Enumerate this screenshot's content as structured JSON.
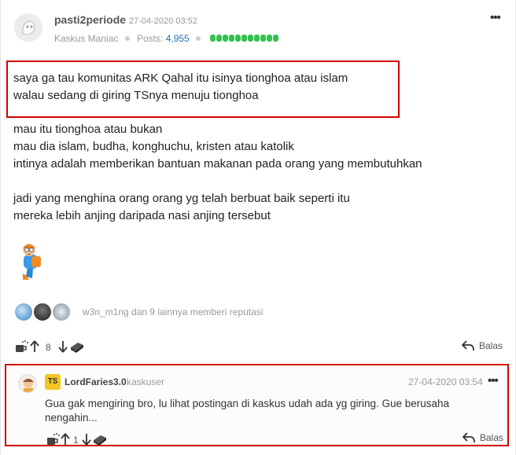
{
  "post": {
    "username": "pasti2periode",
    "timestamp": "27-04-2020 03:52",
    "rank": "Kaskus Maniac",
    "posts_label": "Posts:",
    "posts_count": "4,955",
    "reputation_level": 1.0,
    "highlighted_lines": [
      "saya ga tau komunitas ARK Qahal itu isinya tionghoa atau islam",
      "walau sedang di giring TSnya menuju tionghoa"
    ],
    "body_lines": [
      "mau itu tionghoa atau bukan",
      "mau dia islam, budha, konghuchu, kristen atau katolik",
      "intinya adalah memberikan bantuan makanan pada orang yang membutuhkan",
      "jadi yang menghina orang orang yg telah berbuat baik seperti itu",
      "mereka lebih anjing daripada nasi anjing tersebut"
    ],
    "reputation_text": "w3n_m1ng dan 9 lainnya memberi reputasi",
    "vote_count": "8",
    "reply_label": "Balas",
    "menu_icon": "more-dots-icon"
  },
  "reply": {
    "badge": "TS",
    "username": "LordFaries3.0",
    "rank": "kaskuser",
    "timestamp": "27-04-2020 03:54",
    "text": "Gua gak mengiring bro, lu lihat postingan di kaskus udah ada yg giring. Gue berusaha nengahin...",
    "vote_count": "1",
    "reply_label": "Balas"
  },
  "colors": {
    "highlight_border": "#d10000",
    "reputation_green": "#32c24d",
    "posts_link": "#1e6fb8",
    "ts_badge": "#f3c623"
  }
}
